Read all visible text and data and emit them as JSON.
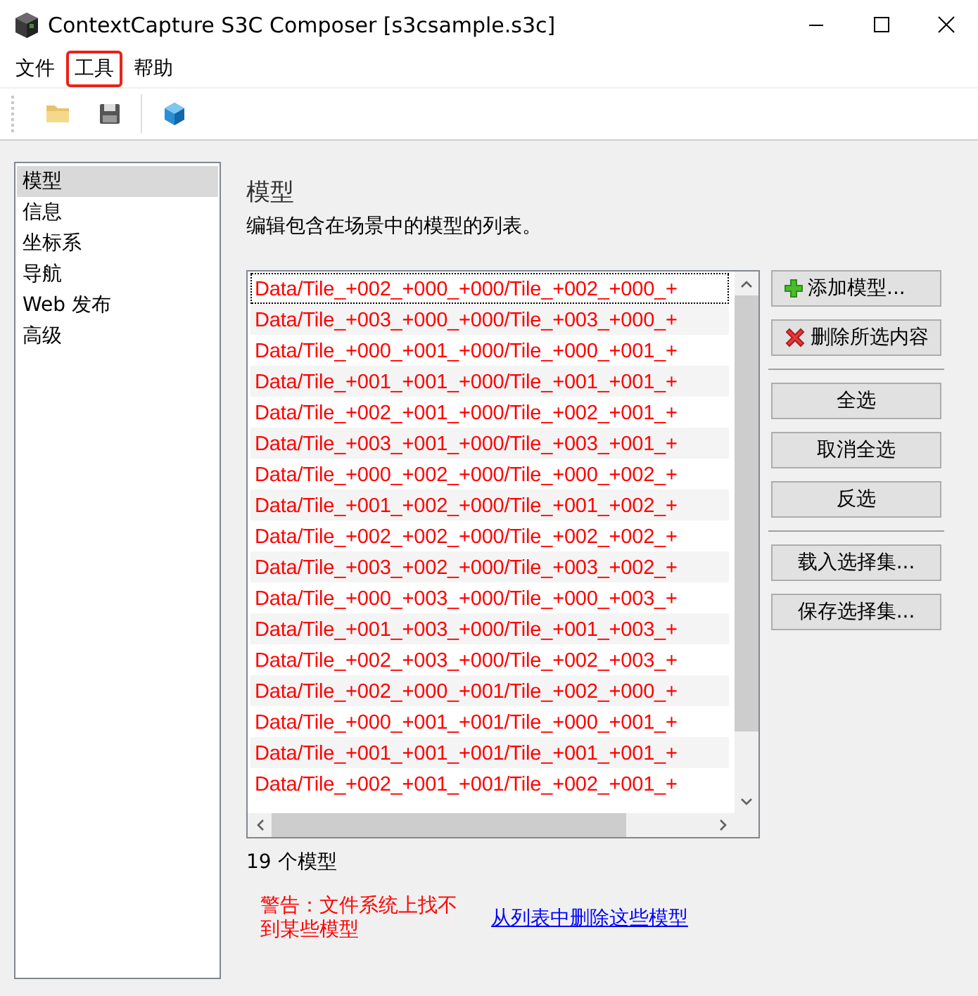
{
  "window": {
    "title": "ContextCapture S3C Composer [s3csample.s3c]"
  },
  "menu": [
    {
      "label": "文件",
      "highlighted": false
    },
    {
      "label": "工具",
      "highlighted": true
    },
    {
      "label": "帮助",
      "highlighted": false
    }
  ],
  "sidebar": {
    "items": [
      {
        "label": "模型",
        "selected": true
      },
      {
        "label": "信息",
        "selected": false
      },
      {
        "label": "坐标系",
        "selected": false
      },
      {
        "label": "导航",
        "selected": false
      },
      {
        "label": "Web 发布",
        "selected": false
      },
      {
        "label": "高级",
        "selected": false
      }
    ]
  },
  "panel": {
    "title": "模型",
    "description": "编辑包含在场景中的模型的列表。",
    "models": [
      {
        "path": "Data/Tile_+002_+000_+000/Tile_+002_+000_+",
        "focused": true
      },
      {
        "path": "Data/Tile_+003_+000_+000/Tile_+003_+000_+",
        "focused": false
      },
      {
        "path": "Data/Tile_+000_+001_+000/Tile_+000_+001_+",
        "focused": false
      },
      {
        "path": "Data/Tile_+001_+001_+000/Tile_+001_+001_+",
        "focused": false
      },
      {
        "path": "Data/Tile_+002_+001_+000/Tile_+002_+001_+",
        "focused": false
      },
      {
        "path": "Data/Tile_+003_+001_+000/Tile_+003_+001_+",
        "focused": false
      },
      {
        "path": "Data/Tile_+000_+002_+000/Tile_+000_+002_+",
        "focused": false
      },
      {
        "path": "Data/Tile_+001_+002_+000/Tile_+001_+002_+",
        "focused": false
      },
      {
        "path": "Data/Tile_+002_+002_+000/Tile_+002_+002_+",
        "focused": false
      },
      {
        "path": "Data/Tile_+003_+002_+000/Tile_+003_+002_+",
        "focused": false
      },
      {
        "path": "Data/Tile_+000_+003_+000/Tile_+000_+003_+",
        "focused": false
      },
      {
        "path": "Data/Tile_+001_+003_+000/Tile_+001_+003_+",
        "focused": false
      },
      {
        "path": "Data/Tile_+002_+003_+000/Tile_+002_+003_+",
        "focused": false
      },
      {
        "path": "Data/Tile_+002_+000_+001/Tile_+002_+000_+",
        "focused": false
      },
      {
        "path": "Data/Tile_+000_+001_+001/Tile_+000_+001_+",
        "focused": false
      },
      {
        "path": "Data/Tile_+001_+001_+001/Tile_+001_+001_+",
        "focused": false
      },
      {
        "path": "Data/Tile_+002_+001_+001/Tile_+002_+001_+",
        "focused": false
      }
    ],
    "button_groups": [
      [
        {
          "label": "添加模型...",
          "kind": "add"
        },
        {
          "label": "删除所选内容",
          "kind": "remove"
        }
      ],
      [
        {
          "label": "全选",
          "kind": "plain"
        },
        {
          "label": "取消全选",
          "kind": "plain"
        },
        {
          "label": "反选",
          "kind": "plain"
        }
      ],
      [
        {
          "label": "载入选择集...",
          "kind": "plain"
        },
        {
          "label": "保存选择集...",
          "kind": "plain"
        }
      ]
    ],
    "count": "19 个模型",
    "warning": "警告：文件系统上找不到某些模型",
    "remove_link": "从列表中删除这些模型"
  }
}
